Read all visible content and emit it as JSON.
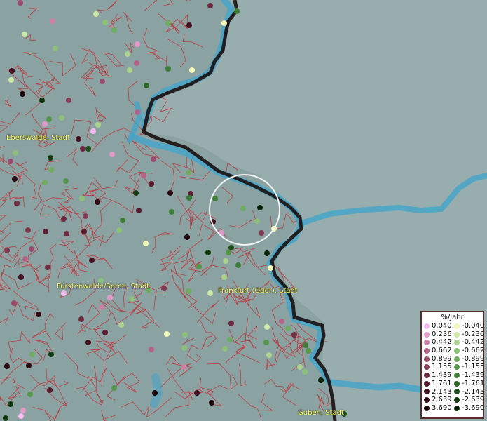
{
  "map": {
    "cities": [
      {
        "name": "Eberswalde, Stadt"
      },
      {
        "name": "Fürstenwalde/Spree, Stadt"
      },
      {
        "name": "Frankfurt (Oder), Stadt"
      },
      {
        "name": "Guben, Stadt"
      }
    ],
    "colors": {
      "land": "#8fa7a6",
      "land_east": "#98aeae",
      "river": "#46a4c8",
      "border": "#1a1010",
      "district_lines": "#c0343a"
    }
  },
  "legend": {
    "title": "%/Jahr",
    "positive": [
      {
        "label": "0.040",
        "color": "#f6b9ee"
      },
      {
        "label": "0.236",
        "color": "#e49ac8"
      },
      {
        "label": "0.442",
        "color": "#cf7fa6"
      },
      {
        "label": "0.662",
        "color": "#b6638a"
      },
      {
        "label": "0.899",
        "color": "#9a4a6c"
      },
      {
        "label": "1.155",
        "color": "#833a54"
      },
      {
        "label": "1.439",
        "color": "#6e2a40"
      },
      {
        "label": "1.761",
        "color": "#581c2e"
      },
      {
        "label": "2.143",
        "color": "#43111f"
      },
      {
        "label": "2.639",
        "color": "#2e0912"
      },
      {
        "label": "3.690",
        "color": "#1c0408"
      }
    ],
    "negative": [
      {
        "label": "-0.040",
        "color": "#f4f8b8"
      },
      {
        "label": "-0.236",
        "color": "#cde7a4"
      },
      {
        "label": "-0.442",
        "color": "#acd38e"
      },
      {
        "label": "-0.662",
        "color": "#8cc078"
      },
      {
        "label": "-0.899",
        "color": "#6fab60"
      },
      {
        "label": "-1.155",
        "color": "#54964a"
      },
      {
        "label": "-1.439",
        "color": "#3e7e38"
      },
      {
        "label": "-1.761",
        "color": "#2c6628"
      },
      {
        "label": "-2.143",
        "color": "#1d4f1b"
      },
      {
        "label": "-2.639",
        "color": "#113a10"
      },
      {
        "label": "-3.690",
        "color": "#072607"
      }
    ]
  }
}
